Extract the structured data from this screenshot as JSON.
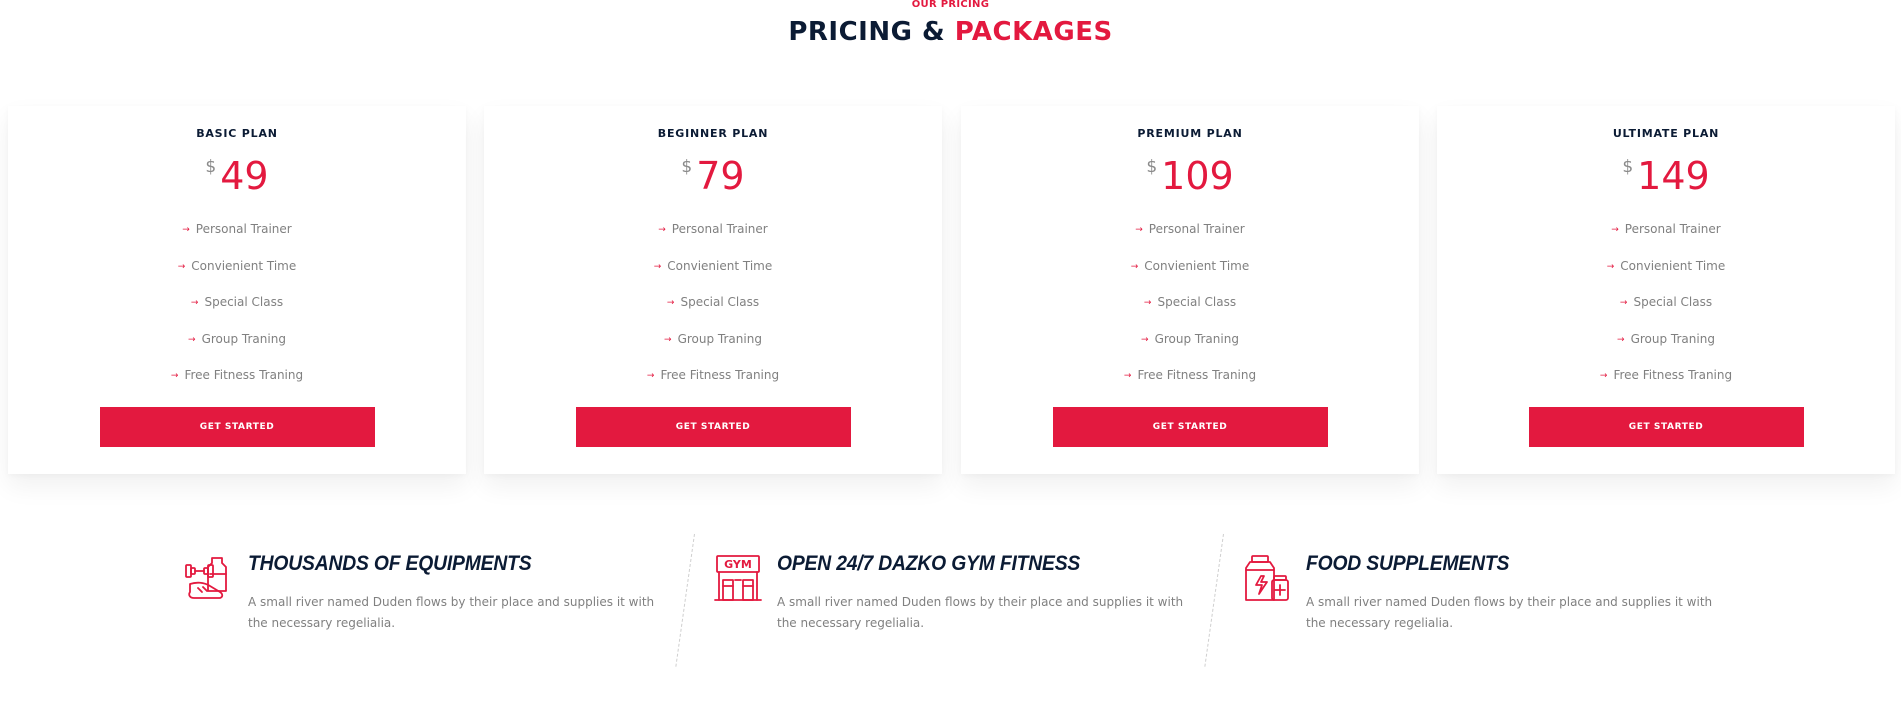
{
  "section": {
    "eyebrow": "Our Pricing",
    "title_part1": "PRICING &",
    "title_part2": "PACKAGES"
  },
  "colors": {
    "accent": "#e3193f",
    "dark": "#0b1b34",
    "muted": "#808080"
  },
  "plans": [
    {
      "name": "BASIC PLAN",
      "currency": "$",
      "price": "49",
      "features": [
        "Personal Trainer",
        "Convienient Time",
        "Special Class",
        "Group Traning",
        "Free Fitness Traning"
      ],
      "button": "GET STARTED"
    },
    {
      "name": "BEGINNER PLAN",
      "currency": "$",
      "price": "79",
      "features": [
        "Personal Trainer",
        "Convienient Time",
        "Special Class",
        "Group Traning",
        "Free Fitness Traning"
      ],
      "button": "GET STARTED"
    },
    {
      "name": "PREMIUM PLAN",
      "currency": "$",
      "price": "109",
      "features": [
        "Personal Trainer",
        "Convienient Time",
        "Special Class",
        "Group Traning",
        "Free Fitness Traning"
      ],
      "button": "GET STARTED"
    },
    {
      "name": "ULTIMATE PLAN",
      "currency": "$",
      "price": "149",
      "features": [
        "Personal Trainer",
        "Convienient Time",
        "Special Class",
        "Group Traning",
        "Free Fitness Traning"
      ],
      "button": "GET STARTED"
    }
  ],
  "highlights": [
    {
      "icon": "equipment-icon",
      "title": "THOUSANDS OF EQUIPMENTS",
      "desc": "A small river named Duden flows by their place and supplies it with the necessary regelialia."
    },
    {
      "icon": "gym-building-icon",
      "icon_text": "GYM",
      "title": "OPEN 24/7 DAZKO GYM FITNESS",
      "desc": "A small river named Duden flows by their place and supplies it with the necessary regelialia."
    },
    {
      "icon": "supplement-jar-icon",
      "title": "FOOD SUPPLEMENTS",
      "desc": "A small river named Duden flows by their place and supplies it with the necessary regelialia."
    }
  ]
}
